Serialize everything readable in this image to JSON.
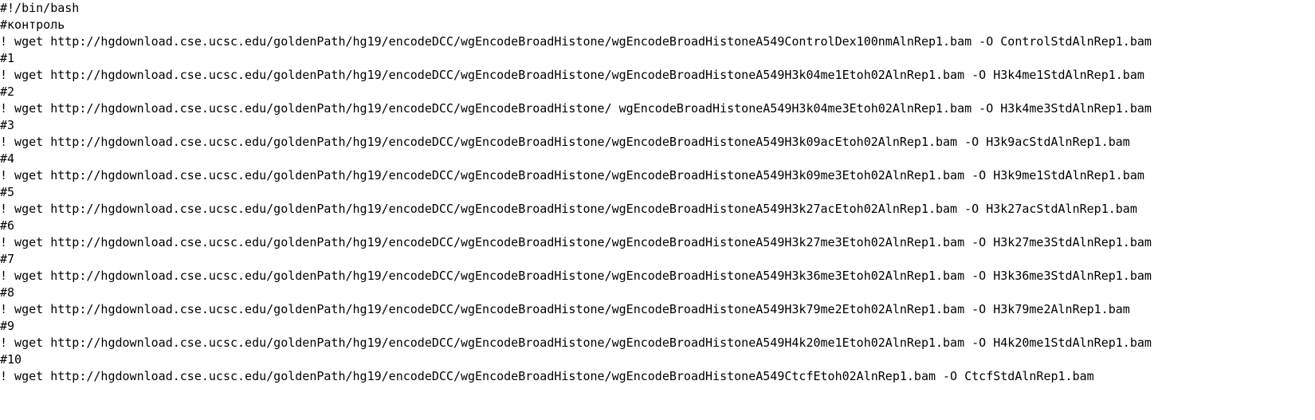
{
  "editor": {
    "lines": [
      "#!/bin/bash",
      "#контроль",
      "! wget http://hgdownload.cse.ucsc.edu/goldenPath/hg19/encodeDCC/wgEncodeBroadHistone/wgEncodeBroadHistoneA549ControlDex100nmAlnRep1.bam -O ControlStdAlnRep1.bam",
      "#1",
      "! wget http://hgdownload.cse.ucsc.edu/goldenPath/hg19/encodeDCC/wgEncodeBroadHistone/wgEncodeBroadHistoneA549H3k04me1Etoh02AlnRep1.bam -O H3k4me1StdAlnRep1.bam",
      "#2",
      "! wget http://hgdownload.cse.ucsc.edu/goldenPath/hg19/encodeDCC/wgEncodeBroadHistone/ wgEncodeBroadHistoneA549H3k04me3Etoh02AlnRep1.bam -O H3k4me3StdAlnRep1.bam",
      "#3",
      "! wget http://hgdownload.cse.ucsc.edu/goldenPath/hg19/encodeDCC/wgEncodeBroadHistone/wgEncodeBroadHistoneA549H3k09acEtoh02AlnRep1.bam -O H3k9acStdAlnRep1.bam",
      "#4",
      "! wget http://hgdownload.cse.ucsc.edu/goldenPath/hg19/encodeDCC/wgEncodeBroadHistone/wgEncodeBroadHistoneA549H3k09me3Etoh02AlnRep1.bam -O H3k9me1StdAlnRep1.bam",
      "#5",
      "! wget http://hgdownload.cse.ucsc.edu/goldenPath/hg19/encodeDCC/wgEncodeBroadHistone/wgEncodeBroadHistoneA549H3k27acEtoh02AlnRep1.bam -O H3k27acStdAlnRep1.bam",
      "#6",
      "! wget http://hgdownload.cse.ucsc.edu/goldenPath/hg19/encodeDCC/wgEncodeBroadHistone/wgEncodeBroadHistoneA549H3k27me3Etoh02AlnRep1.bam -O H3k27me3StdAlnRep1.bam",
      "#7",
      "! wget http://hgdownload.cse.ucsc.edu/goldenPath/hg19/encodeDCC/wgEncodeBroadHistone/wgEncodeBroadHistoneA549H3k36me3Etoh02AlnRep1.bam -O H3k36me3StdAlnRep1.bam",
      "#8",
      "! wget http://hgdownload.cse.ucsc.edu/goldenPath/hg19/encodeDCC/wgEncodeBroadHistone/wgEncodeBroadHistoneA549H3k79me2Etoh02AlnRep1.bam -O H3k79me2AlnRep1.bam",
      "#9",
      "! wget http://hgdownload.cse.ucsc.edu/goldenPath/hg19/encodeDCC/wgEncodeBroadHistone/wgEncodeBroadHistoneA549H4k20me1Etoh02AlnRep1.bam -O H4k20me1StdAlnRep1.bam",
      "#10",
      "! wget http://hgdownload.cse.ucsc.edu/goldenPath/hg19/encodeDCC/wgEncodeBroadHistone/wgEncodeBroadHistoneA549CtcfEtoh02AlnRep1.bam -O CtcfStdAlnRep1.bam"
    ]
  }
}
